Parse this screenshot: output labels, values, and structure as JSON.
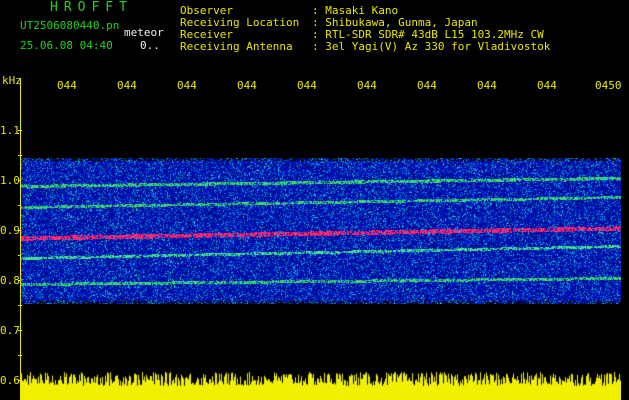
{
  "header": {
    "title": "HROFFT",
    "filename": "UT2506080440.pn",
    "event": "meteor",
    "date_time": "25.06.08 04:40",
    "count": "0..",
    "fields": [
      {
        "label": "Observer",
        "value": ": Masaki Kano"
      },
      {
        "label": "Receiving Location",
        "value": ": Shibukawa, Gunma, Japan"
      },
      {
        "label": "Receiver",
        "value": ": RTL-SDR SDR# 43dB L15 103.2MHz CW"
      },
      {
        "label": "Receiving Antenna",
        "value": ": 3el Yagi(V) Az 330 for Vladivostok"
      }
    ]
  },
  "time_axis": {
    "ticks": [
      "044",
      "044",
      "044",
      "044",
      "044",
      "044",
      "044",
      "044",
      "044",
      "0450"
    ]
  },
  "freq_axis": {
    "unit": "kHz",
    "labels": [
      "1.1",
      "1.0",
      "0.9",
      "0.8",
      "0.7",
      "0.6"
    ]
  },
  "colors": {
    "background": "#000000",
    "header_green": "#1fd41f",
    "header_yellow": "#e8e800",
    "axis_yellow": "#e8e800",
    "signal_magenta": "#ff2a6a",
    "noise_blue": "#1a2ad8",
    "trace_green": "#3cd96a"
  }
}
